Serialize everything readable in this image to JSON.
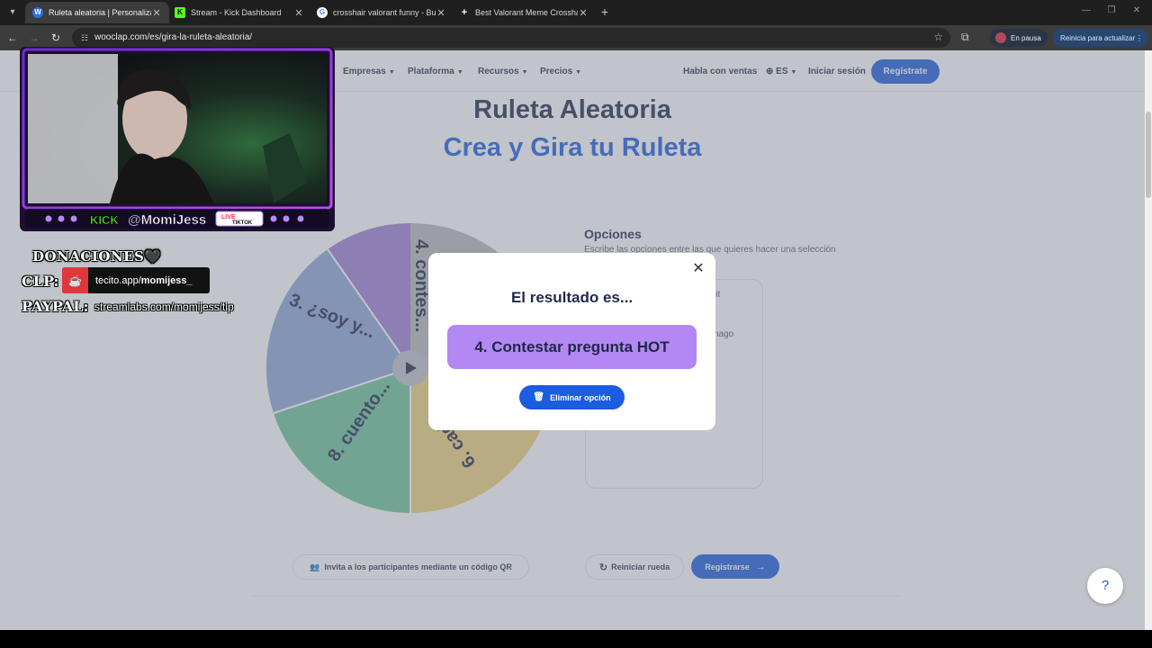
{
  "browser": {
    "tabs": [
      {
        "label": "Ruleta aleatoria | Personaliza y g",
        "favicon": "W",
        "active": true
      },
      {
        "label": "Stream - Kick Dashboard",
        "favicon": "K",
        "active": false
      },
      {
        "label": "crosshair valorant funny - Busca",
        "favicon": "G",
        "active": false
      },
      {
        "label": "Best Valorant Meme Crosshairs",
        "favicon": "+",
        "active": false
      }
    ],
    "url": "wooclap.com/es/gira-la-ruleta-aleatoria/",
    "profile_status": "En pausa",
    "update_label": "Reinicia para actualizar"
  },
  "site_nav": {
    "items": [
      "Empresas",
      "Plataforma",
      "Recursos",
      "Precios"
    ],
    "sales": "Habla con ventas",
    "language": "ES",
    "login": "Iniciar sesión",
    "register": "Regístrate"
  },
  "hero": {
    "title": "Ruleta Aleatoria",
    "subtitle": "Crea y Gira tu Ruleta"
  },
  "wheel": {
    "segment_labels": [
      "4. contes...",
      "3. ¿soy y...",
      "8. cuento...",
      "6. cad..."
    ],
    "segment_colors": [
      "#a07fd6",
      "#8fa6d6",
      "#6cc49a",
      "#f1d27a"
    ]
  },
  "options_panel": {
    "title": "Opciones",
    "description": "Escribe las opciones entre las que quieres hacer una selección",
    "visible_fragments": [
      "lit",
      "hago"
    ]
  },
  "actions": {
    "qr": "Invita a los participantes mediante un código QR",
    "reset": "Reiniciar rueda",
    "signup": "Registrarse"
  },
  "modal": {
    "heading": "El resultado es...",
    "result": "4. Contestar pregunta HOT",
    "delete": "Eliminar opción",
    "result_color": "#b388f2"
  },
  "help": {
    "label": "?"
  },
  "stream_overlay": {
    "handle": "@MomiJess",
    "kick_label": "KICK",
    "tiktok_live": "LIVE",
    "tiktok_label": "TIKTOK",
    "donations_title": "DONACIONES🖤",
    "clp_label": "CLP:",
    "tecito_prefix": "tecito.app/",
    "tecito_user": "momijess_",
    "paypal_label": "PAYPAL:",
    "paypal_link": "streamlabs.com/momijess/tip",
    "accent_color": "#a44df0"
  }
}
